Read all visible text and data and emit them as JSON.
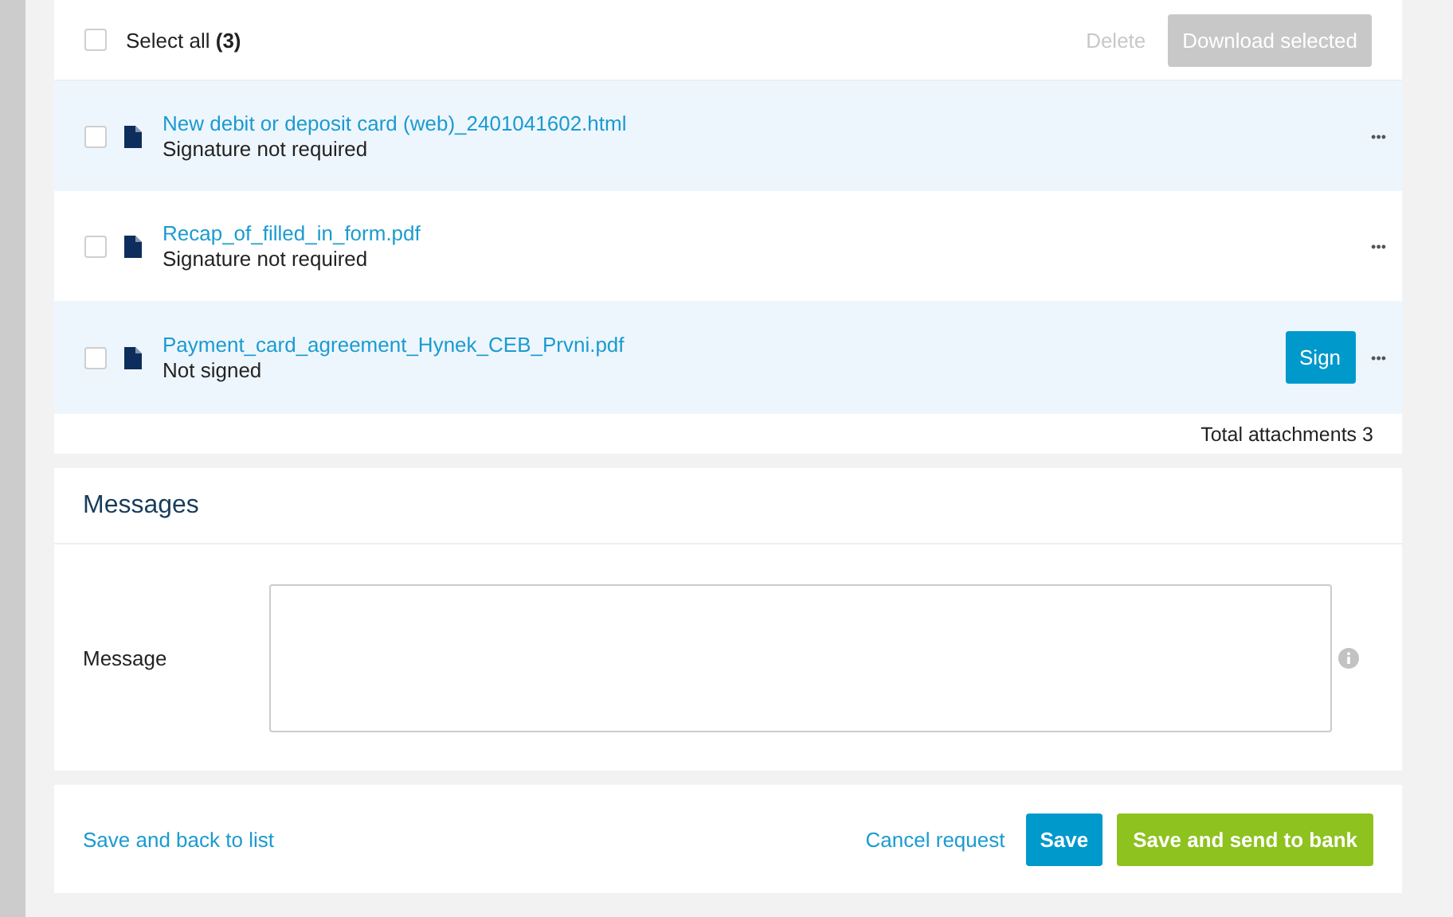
{
  "attachments": {
    "select_all": {
      "label": "Select all",
      "count": "(3)",
      "checked": false
    },
    "actions": [
      {
        "label": "Delete",
        "kind": "link",
        "disabled": true
      },
      {
        "label": "Download selected",
        "kind": "button",
        "disabled": true
      }
    ],
    "files": [
      {
        "name": "New debit or deposit card (web)_2401041602.html",
        "status": "Signature not required",
        "checked": false,
        "menu": "•••"
      },
      {
        "name": "Recap_of_filled_in_form.pdf",
        "status": "Signature not required",
        "checked": false,
        "menu": "•••"
      },
      {
        "name": "Payment_card_agreement_Hynek_CEB_Prvni.pdf",
        "status": "Not signed",
        "checked": false,
        "action": "Sign",
        "menu": "•••"
      }
    ],
    "total": "Total attachments 3"
  },
  "messages": {
    "title": "Messages",
    "label": "Message"
  },
  "footer": {
    "back_link": "Save and back to list",
    "cancel_link": "Cancel request",
    "save": "Save",
    "send": "Save and send to bank"
  }
}
